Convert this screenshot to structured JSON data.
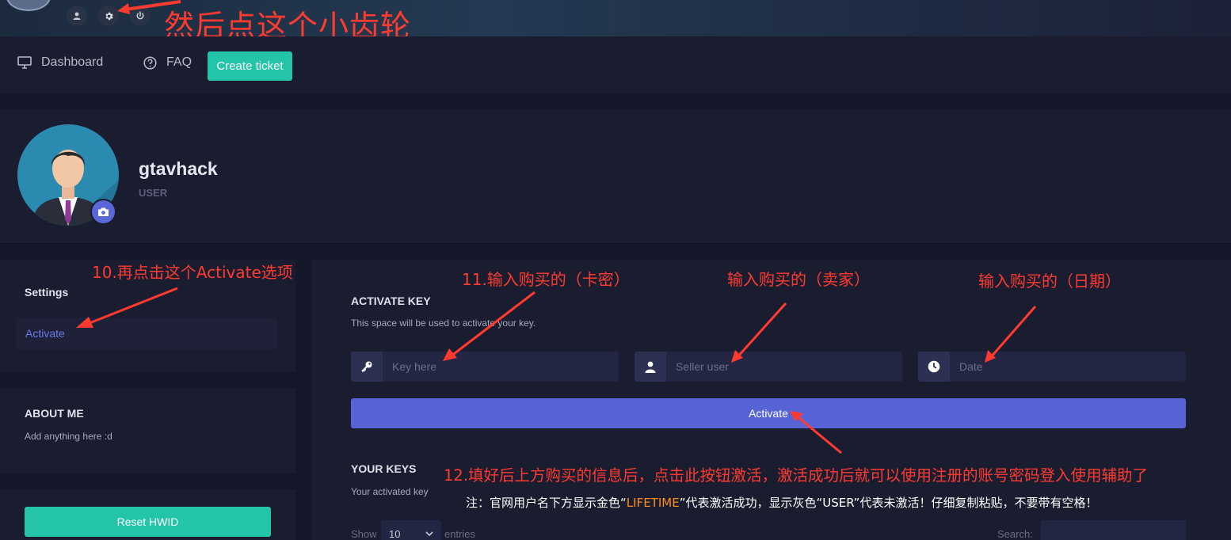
{
  "header": {
    "annotation": "然后点这个小齿轮",
    "icons": [
      "user-icon",
      "gear-icon",
      "power-icon"
    ]
  },
  "nav": {
    "dashboard": "Dashboard",
    "faq": "FAQ",
    "create_ticket": "Create ticket"
  },
  "profile": {
    "username": "gtavhack",
    "role": "USER"
  },
  "settings_panel": {
    "title": "Settings",
    "activate": "Activate",
    "annotation": "10.再点击这个Activate选项"
  },
  "about_panel": {
    "title": "ABOUT ME",
    "text": "Add anything here :d"
  },
  "reset_panel": {
    "button": "Reset HWID"
  },
  "activate_key": {
    "title": "ACTIVATE KEY",
    "subtitle": "This space will be used to activate your key.",
    "key_placeholder": "Key here",
    "seller_placeholder": "Seller user",
    "date_placeholder": "Date",
    "button": "Activate",
    "annotation_key": "11.输入购买的（卡密）",
    "annotation_seller": "输入购买的（卖家）",
    "annotation_date": "输入购买的（日期）"
  },
  "your_keys": {
    "title": "YOUR KEYS",
    "subtitle": "Your activated key",
    "annotation": "12.填好后上方购买的信息后，点击此按钮激活，激活成功后就可以使用注册的账号密码登入使用辅助了",
    "note_part1": "注：官网用户名下方显示金色“",
    "note_gold": "LIFETIME",
    "note_part2": "”代表激活成功，显示灰色“USER”代表未激活！仔细复制粘贴，不要带有空格！",
    "show_label": "Show",
    "show_value": "10",
    "entries_label": "entries",
    "search_label": "Search:"
  },
  "colors": {
    "accent_teal": "#24c4a8",
    "accent_blue": "#5864d6",
    "annotation_red": "#ff3b30",
    "note_gold": "#ff8c1a"
  }
}
